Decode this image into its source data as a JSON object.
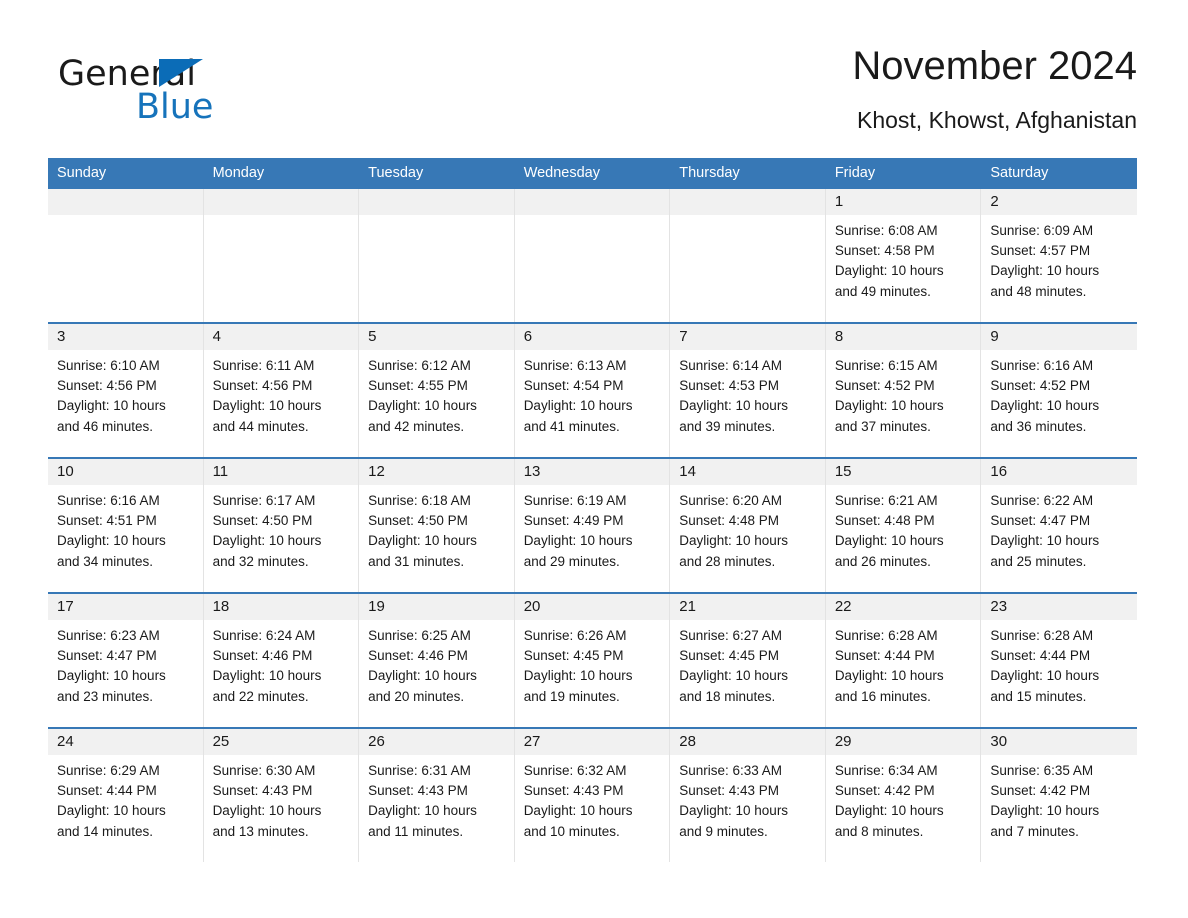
{
  "brand": {
    "logo_text_primary": "General",
    "logo_text_secondary": "Blue",
    "logo_blue": "#1673bb",
    "triangle_blue": "#0b6cb7"
  },
  "header": {
    "title": "November 2024",
    "subtitle": "Khost, Khowst, Afghanistan"
  },
  "theme": {
    "header_bar": "#3778b6",
    "date_band": "#f1f1f1",
    "row_divider": "#3778b6",
    "text": "#1a1a1a"
  },
  "calendar": {
    "weekday_headers": [
      "Sunday",
      "Monday",
      "Tuesday",
      "Wednesday",
      "Thursday",
      "Friday",
      "Saturday"
    ],
    "weeks": [
      [
        {
          "date": "",
          "sunrise": "",
          "sunset": "",
          "daylight_line1": "",
          "daylight_line2": ""
        },
        {
          "date": "",
          "sunrise": "",
          "sunset": "",
          "daylight_line1": "",
          "daylight_line2": ""
        },
        {
          "date": "",
          "sunrise": "",
          "sunset": "",
          "daylight_line1": "",
          "daylight_line2": ""
        },
        {
          "date": "",
          "sunrise": "",
          "sunset": "",
          "daylight_line1": "",
          "daylight_line2": ""
        },
        {
          "date": "",
          "sunrise": "",
          "sunset": "",
          "daylight_line1": "",
          "daylight_line2": ""
        },
        {
          "date": "1",
          "sunrise": "Sunrise: 6:08 AM",
          "sunset": "Sunset: 4:58 PM",
          "daylight_line1": "Daylight: 10 hours",
          "daylight_line2": "and 49 minutes."
        },
        {
          "date": "2",
          "sunrise": "Sunrise: 6:09 AM",
          "sunset": "Sunset: 4:57 PM",
          "daylight_line1": "Daylight: 10 hours",
          "daylight_line2": "and 48 minutes."
        }
      ],
      [
        {
          "date": "3",
          "sunrise": "Sunrise: 6:10 AM",
          "sunset": "Sunset: 4:56 PM",
          "daylight_line1": "Daylight: 10 hours",
          "daylight_line2": "and 46 minutes."
        },
        {
          "date": "4",
          "sunrise": "Sunrise: 6:11 AM",
          "sunset": "Sunset: 4:56 PM",
          "daylight_line1": "Daylight: 10 hours",
          "daylight_line2": "and 44 minutes."
        },
        {
          "date": "5",
          "sunrise": "Sunrise: 6:12 AM",
          "sunset": "Sunset: 4:55 PM",
          "daylight_line1": "Daylight: 10 hours",
          "daylight_line2": "and 42 minutes."
        },
        {
          "date": "6",
          "sunrise": "Sunrise: 6:13 AM",
          "sunset": "Sunset: 4:54 PM",
          "daylight_line1": "Daylight: 10 hours",
          "daylight_line2": "and 41 minutes."
        },
        {
          "date": "7",
          "sunrise": "Sunrise: 6:14 AM",
          "sunset": "Sunset: 4:53 PM",
          "daylight_line1": "Daylight: 10 hours",
          "daylight_line2": "and 39 minutes."
        },
        {
          "date": "8",
          "sunrise": "Sunrise: 6:15 AM",
          "sunset": "Sunset: 4:52 PM",
          "daylight_line1": "Daylight: 10 hours",
          "daylight_line2": "and 37 minutes."
        },
        {
          "date": "9",
          "sunrise": "Sunrise: 6:16 AM",
          "sunset": "Sunset: 4:52 PM",
          "daylight_line1": "Daylight: 10 hours",
          "daylight_line2": "and 36 minutes."
        }
      ],
      [
        {
          "date": "10",
          "sunrise": "Sunrise: 6:16 AM",
          "sunset": "Sunset: 4:51 PM",
          "daylight_line1": "Daylight: 10 hours",
          "daylight_line2": "and 34 minutes."
        },
        {
          "date": "11",
          "sunrise": "Sunrise: 6:17 AM",
          "sunset": "Sunset: 4:50 PM",
          "daylight_line1": "Daylight: 10 hours",
          "daylight_line2": "and 32 minutes."
        },
        {
          "date": "12",
          "sunrise": "Sunrise: 6:18 AM",
          "sunset": "Sunset: 4:50 PM",
          "daylight_line1": "Daylight: 10 hours",
          "daylight_line2": "and 31 minutes."
        },
        {
          "date": "13",
          "sunrise": "Sunrise: 6:19 AM",
          "sunset": "Sunset: 4:49 PM",
          "daylight_line1": "Daylight: 10 hours",
          "daylight_line2": "and 29 minutes."
        },
        {
          "date": "14",
          "sunrise": "Sunrise: 6:20 AM",
          "sunset": "Sunset: 4:48 PM",
          "daylight_line1": "Daylight: 10 hours",
          "daylight_line2": "and 28 minutes."
        },
        {
          "date": "15",
          "sunrise": "Sunrise: 6:21 AM",
          "sunset": "Sunset: 4:48 PM",
          "daylight_line1": "Daylight: 10 hours",
          "daylight_line2": "and 26 minutes."
        },
        {
          "date": "16",
          "sunrise": "Sunrise: 6:22 AM",
          "sunset": "Sunset: 4:47 PM",
          "daylight_line1": "Daylight: 10 hours",
          "daylight_line2": "and 25 minutes."
        }
      ],
      [
        {
          "date": "17",
          "sunrise": "Sunrise: 6:23 AM",
          "sunset": "Sunset: 4:47 PM",
          "daylight_line1": "Daylight: 10 hours",
          "daylight_line2": "and 23 minutes."
        },
        {
          "date": "18",
          "sunrise": "Sunrise: 6:24 AM",
          "sunset": "Sunset: 4:46 PM",
          "daylight_line1": "Daylight: 10 hours",
          "daylight_line2": "and 22 minutes."
        },
        {
          "date": "19",
          "sunrise": "Sunrise: 6:25 AM",
          "sunset": "Sunset: 4:46 PM",
          "daylight_line1": "Daylight: 10 hours",
          "daylight_line2": "and 20 minutes."
        },
        {
          "date": "20",
          "sunrise": "Sunrise: 6:26 AM",
          "sunset": "Sunset: 4:45 PM",
          "daylight_line1": "Daylight: 10 hours",
          "daylight_line2": "and 19 minutes."
        },
        {
          "date": "21",
          "sunrise": "Sunrise: 6:27 AM",
          "sunset": "Sunset: 4:45 PM",
          "daylight_line1": "Daylight: 10 hours",
          "daylight_line2": "and 18 minutes."
        },
        {
          "date": "22",
          "sunrise": "Sunrise: 6:28 AM",
          "sunset": "Sunset: 4:44 PM",
          "daylight_line1": "Daylight: 10 hours",
          "daylight_line2": "and 16 minutes."
        },
        {
          "date": "23",
          "sunrise": "Sunrise: 6:28 AM",
          "sunset": "Sunset: 4:44 PM",
          "daylight_line1": "Daylight: 10 hours",
          "daylight_line2": "and 15 minutes."
        }
      ],
      [
        {
          "date": "24",
          "sunrise": "Sunrise: 6:29 AM",
          "sunset": "Sunset: 4:44 PM",
          "daylight_line1": "Daylight: 10 hours",
          "daylight_line2": "and 14 minutes."
        },
        {
          "date": "25",
          "sunrise": "Sunrise: 6:30 AM",
          "sunset": "Sunset: 4:43 PM",
          "daylight_line1": "Daylight: 10 hours",
          "daylight_line2": "and 13 minutes."
        },
        {
          "date": "26",
          "sunrise": "Sunrise: 6:31 AM",
          "sunset": "Sunset: 4:43 PM",
          "daylight_line1": "Daylight: 10 hours",
          "daylight_line2": "and 11 minutes."
        },
        {
          "date": "27",
          "sunrise": "Sunrise: 6:32 AM",
          "sunset": "Sunset: 4:43 PM",
          "daylight_line1": "Daylight: 10 hours",
          "daylight_line2": "and 10 minutes."
        },
        {
          "date": "28",
          "sunrise": "Sunrise: 6:33 AM",
          "sunset": "Sunset: 4:43 PM",
          "daylight_line1": "Daylight: 10 hours",
          "daylight_line2": "and 9 minutes."
        },
        {
          "date": "29",
          "sunrise": "Sunrise: 6:34 AM",
          "sunset": "Sunset: 4:42 PM",
          "daylight_line1": "Daylight: 10 hours",
          "daylight_line2": "and 8 minutes."
        },
        {
          "date": "30",
          "sunrise": "Sunrise: 6:35 AM",
          "sunset": "Sunset: 4:42 PM",
          "daylight_line1": "Daylight: 10 hours",
          "daylight_line2": "and 7 minutes."
        }
      ]
    ]
  }
}
